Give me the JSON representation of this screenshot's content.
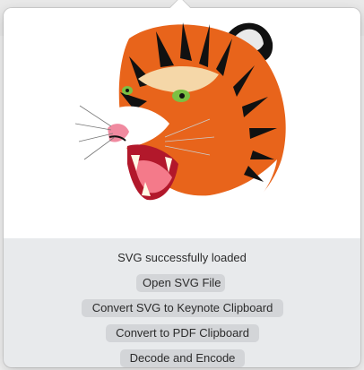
{
  "status": {
    "message": "SVG successfully loaded"
  },
  "buttons": {
    "open_svg": "Open SVG File",
    "convert_keynote": "Convert SVG to Keynote Clipboard",
    "convert_pdf": "Convert to PDF Clipboard",
    "decode_encode": "Decode and Encode"
  },
  "preview": {
    "icon": "tiger-svg-image"
  }
}
